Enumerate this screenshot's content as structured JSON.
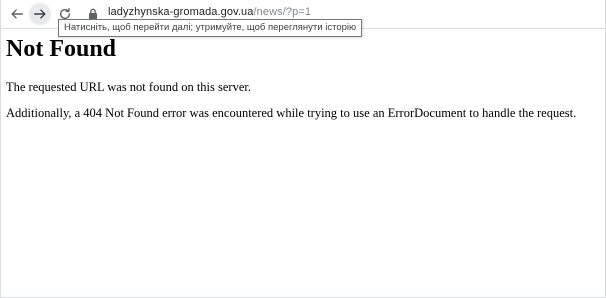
{
  "browser": {
    "back_icon": "arrow-left-icon",
    "forward_icon": "arrow-right-icon",
    "reload_icon": "reload-icon",
    "lock_icon": "lock-icon",
    "url_domain": "ladyzhynska-gromada.gov.ua",
    "url_path": "/news/?p=1",
    "tooltip": "Натисніть, щоб перейти далі; утримуйте, щоб переглянути історію"
  },
  "page": {
    "title": "Not Found",
    "paragraph1": "The requested URL was not found on this server.",
    "paragraph2": "Additionally, a 404 Not Found error was encountered while trying to use an ErrorDocument to handle the request."
  }
}
